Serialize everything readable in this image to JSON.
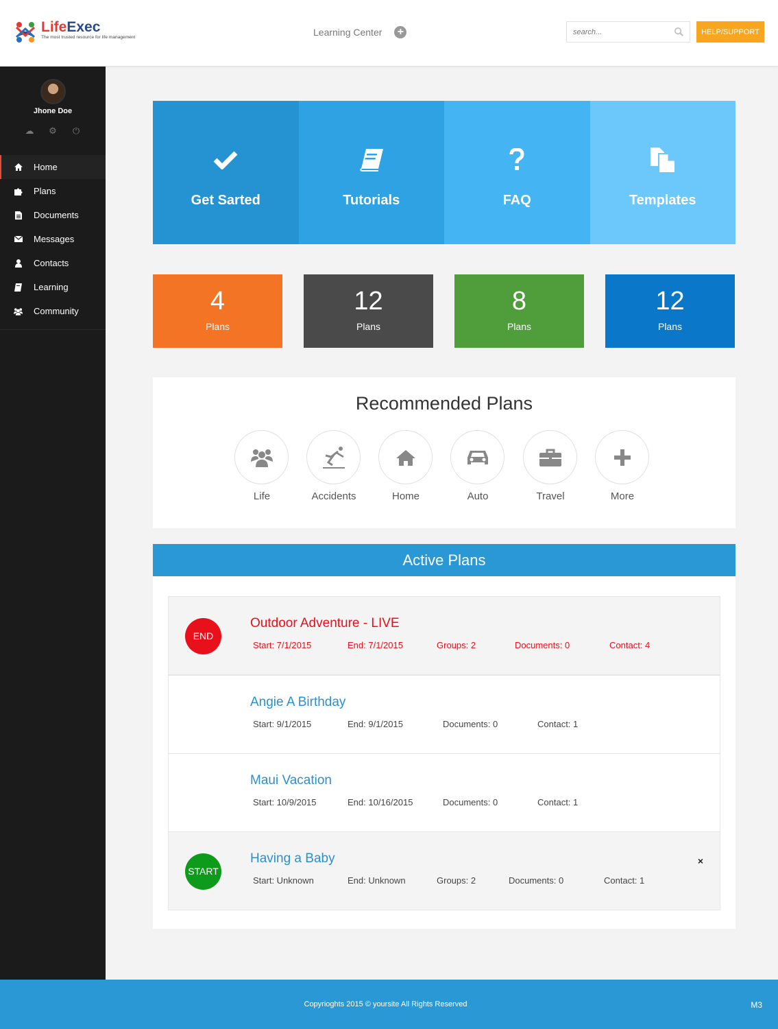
{
  "header": {
    "logo_part1": "Life",
    "logo_part2": "Exec",
    "tagline": "The most trusted resource for life management",
    "learning_center": "Learning Center",
    "search_placeholder": "search...",
    "help_button": "HELP/SUPPORT"
  },
  "user": {
    "name": "Jhone Doe"
  },
  "sidebar": {
    "items": [
      {
        "label": "Home",
        "icon": "home-icon"
      },
      {
        "label": "Plans",
        "icon": "puzzle-icon"
      },
      {
        "label": "Documents",
        "icon": "document-icon"
      },
      {
        "label": "Messages",
        "icon": "envelope-icon"
      },
      {
        "label": "Contacts",
        "icon": "user-icon"
      },
      {
        "label": "Learning",
        "icon": "book-icon"
      },
      {
        "label": "Community",
        "icon": "users-icon"
      }
    ]
  },
  "tiles": [
    {
      "label": "Get Sarted",
      "icon": "checkmark-icon",
      "color": "#2593d2"
    },
    {
      "label": "Tutorials",
      "icon": "book-icon",
      "color": "#2fa2e4"
    },
    {
      "label": "FAQ",
      "icon": "question-icon",
      "color": "#45b4f2"
    },
    {
      "label": "Templates",
      "icon": "copy-icon",
      "color": "#6cc7fb"
    }
  ],
  "stats": [
    {
      "number": "4",
      "label": "Plans",
      "color": "#f37424"
    },
    {
      "number": "12",
      "label": "Plans",
      "color": "#4a4a4a"
    },
    {
      "number": "8",
      "label": "Plans",
      "color": "#4f9d3b"
    },
    {
      "number": "12",
      "label": "Plans",
      "color": "#0a77c8"
    }
  ],
  "recommended": {
    "title": "Recommended Plans",
    "items": [
      {
        "label": "Life",
        "icon": "users-icon"
      },
      {
        "label": "Accidents",
        "icon": "falling-person-icon"
      },
      {
        "label": "Home",
        "icon": "home-icon"
      },
      {
        "label": "Auto",
        "icon": "car-icon"
      },
      {
        "label": "Travel",
        "icon": "briefcase-icon"
      },
      {
        "label": "More",
        "icon": "plus-icon"
      }
    ]
  },
  "active_plans": {
    "title": "Active Plans",
    "plans": [
      {
        "badge": "END",
        "badge_color": "#e8101a",
        "title": "Outdoor Adventure - LIVE",
        "title_color": "#e8101a",
        "meta_color": "#e8101a",
        "start": "Start: 7/1/2015",
        "end": "End: 7/1/2015",
        "groups": "Groups: 2",
        "documents": "Documents: 0",
        "contact": "Contact: 4"
      },
      {
        "title": "Angie A Birthday",
        "title_color": "#2b8fd0",
        "start": "Start: 9/1/2015",
        "end": "End: 9/1/2015",
        "documents": "Documents: 0",
        "contact": "Contact: 1"
      },
      {
        "title": "Maui Vacation",
        "title_color": "#2b8fd0",
        "start": "Start: 10/9/2015",
        "end": "End: 10/16/2015",
        "documents": "Documents: 0",
        "contact": "Contact: 1"
      },
      {
        "badge": "START",
        "badge_color": "#0e9a1a",
        "title": "Having a Baby",
        "title_color": "#2b8fd0",
        "start": "Start: Unknown",
        "end": "End: Unknown",
        "groups": "Groups: 2",
        "documents": "Documents: 0",
        "contact": "Contact: 1",
        "close": "×"
      }
    ]
  },
  "footer": {
    "copyright": "Copyrioghts 2015 © yoursite All Rights Reserved",
    "version": "M3"
  }
}
